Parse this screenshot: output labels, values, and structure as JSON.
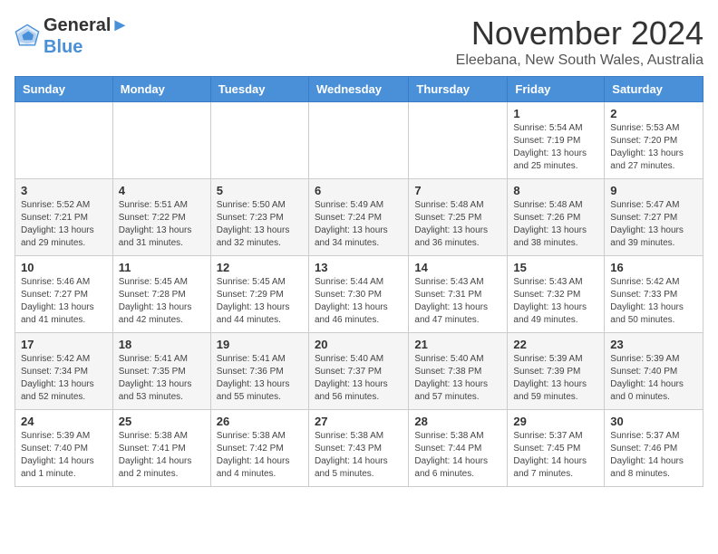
{
  "logo": {
    "line1": "General",
    "line2": "Blue"
  },
  "title": "November 2024",
  "subtitle": "Eleebana, New South Wales, Australia",
  "days_of_week": [
    "Sunday",
    "Monday",
    "Tuesday",
    "Wednesday",
    "Thursday",
    "Friday",
    "Saturday"
  ],
  "weeks": [
    [
      {
        "day": "",
        "info": ""
      },
      {
        "day": "",
        "info": ""
      },
      {
        "day": "",
        "info": ""
      },
      {
        "day": "",
        "info": ""
      },
      {
        "day": "",
        "info": ""
      },
      {
        "day": "1",
        "info": "Sunrise: 5:54 AM\nSunset: 7:19 PM\nDaylight: 13 hours\nand 25 minutes."
      },
      {
        "day": "2",
        "info": "Sunrise: 5:53 AM\nSunset: 7:20 PM\nDaylight: 13 hours\nand 27 minutes."
      }
    ],
    [
      {
        "day": "3",
        "info": "Sunrise: 5:52 AM\nSunset: 7:21 PM\nDaylight: 13 hours\nand 29 minutes."
      },
      {
        "day": "4",
        "info": "Sunrise: 5:51 AM\nSunset: 7:22 PM\nDaylight: 13 hours\nand 31 minutes."
      },
      {
        "day": "5",
        "info": "Sunrise: 5:50 AM\nSunset: 7:23 PM\nDaylight: 13 hours\nand 32 minutes."
      },
      {
        "day": "6",
        "info": "Sunrise: 5:49 AM\nSunset: 7:24 PM\nDaylight: 13 hours\nand 34 minutes."
      },
      {
        "day": "7",
        "info": "Sunrise: 5:48 AM\nSunset: 7:25 PM\nDaylight: 13 hours\nand 36 minutes."
      },
      {
        "day": "8",
        "info": "Sunrise: 5:48 AM\nSunset: 7:26 PM\nDaylight: 13 hours\nand 38 minutes."
      },
      {
        "day": "9",
        "info": "Sunrise: 5:47 AM\nSunset: 7:27 PM\nDaylight: 13 hours\nand 39 minutes."
      }
    ],
    [
      {
        "day": "10",
        "info": "Sunrise: 5:46 AM\nSunset: 7:27 PM\nDaylight: 13 hours\nand 41 minutes."
      },
      {
        "day": "11",
        "info": "Sunrise: 5:45 AM\nSunset: 7:28 PM\nDaylight: 13 hours\nand 42 minutes."
      },
      {
        "day": "12",
        "info": "Sunrise: 5:45 AM\nSunset: 7:29 PM\nDaylight: 13 hours\nand 44 minutes."
      },
      {
        "day": "13",
        "info": "Sunrise: 5:44 AM\nSunset: 7:30 PM\nDaylight: 13 hours\nand 46 minutes."
      },
      {
        "day": "14",
        "info": "Sunrise: 5:43 AM\nSunset: 7:31 PM\nDaylight: 13 hours\nand 47 minutes."
      },
      {
        "day": "15",
        "info": "Sunrise: 5:43 AM\nSunset: 7:32 PM\nDaylight: 13 hours\nand 49 minutes."
      },
      {
        "day": "16",
        "info": "Sunrise: 5:42 AM\nSunset: 7:33 PM\nDaylight: 13 hours\nand 50 minutes."
      }
    ],
    [
      {
        "day": "17",
        "info": "Sunrise: 5:42 AM\nSunset: 7:34 PM\nDaylight: 13 hours\nand 52 minutes."
      },
      {
        "day": "18",
        "info": "Sunrise: 5:41 AM\nSunset: 7:35 PM\nDaylight: 13 hours\nand 53 minutes."
      },
      {
        "day": "19",
        "info": "Sunrise: 5:41 AM\nSunset: 7:36 PM\nDaylight: 13 hours\nand 55 minutes."
      },
      {
        "day": "20",
        "info": "Sunrise: 5:40 AM\nSunset: 7:37 PM\nDaylight: 13 hours\nand 56 minutes."
      },
      {
        "day": "21",
        "info": "Sunrise: 5:40 AM\nSunset: 7:38 PM\nDaylight: 13 hours\nand 57 minutes."
      },
      {
        "day": "22",
        "info": "Sunrise: 5:39 AM\nSunset: 7:39 PM\nDaylight: 13 hours\nand 59 minutes."
      },
      {
        "day": "23",
        "info": "Sunrise: 5:39 AM\nSunset: 7:40 PM\nDaylight: 14 hours\nand 0 minutes."
      }
    ],
    [
      {
        "day": "24",
        "info": "Sunrise: 5:39 AM\nSunset: 7:40 PM\nDaylight: 14 hours\nand 1 minute."
      },
      {
        "day": "25",
        "info": "Sunrise: 5:38 AM\nSunset: 7:41 PM\nDaylight: 14 hours\nand 2 minutes."
      },
      {
        "day": "26",
        "info": "Sunrise: 5:38 AM\nSunset: 7:42 PM\nDaylight: 14 hours\nand 4 minutes."
      },
      {
        "day": "27",
        "info": "Sunrise: 5:38 AM\nSunset: 7:43 PM\nDaylight: 14 hours\nand 5 minutes."
      },
      {
        "day": "28",
        "info": "Sunrise: 5:38 AM\nSunset: 7:44 PM\nDaylight: 14 hours\nand 6 minutes."
      },
      {
        "day": "29",
        "info": "Sunrise: 5:37 AM\nSunset: 7:45 PM\nDaylight: 14 hours\nand 7 minutes."
      },
      {
        "day": "30",
        "info": "Sunrise: 5:37 AM\nSunset: 7:46 PM\nDaylight: 14 hours\nand 8 minutes."
      }
    ]
  ]
}
